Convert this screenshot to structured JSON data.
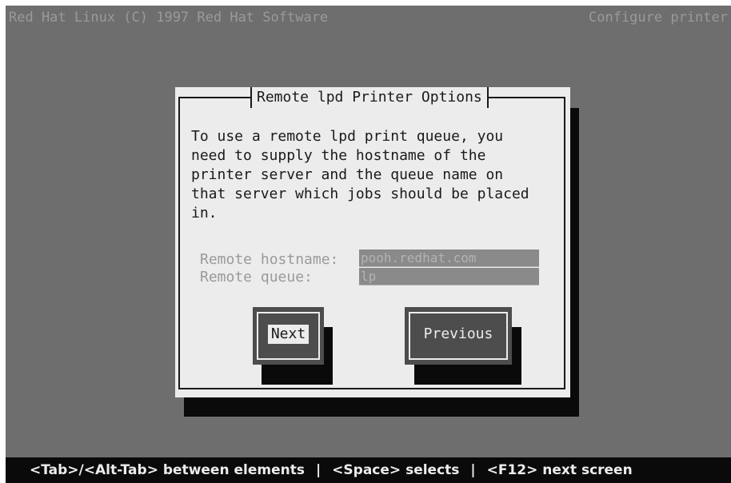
{
  "window": {
    "title_left": "Red Hat Linux (C) 1997 Red Hat Software",
    "title_right": "Configure printer"
  },
  "dialog": {
    "title": "Remote lpd Printer Options",
    "text_lines": [
      "To use a remote lpd print queue, you",
      "need to supply the hostname of the",
      "printer server and the queue name on",
      "that server which jobs should be placed",
      "in."
    ],
    "fields": {
      "hostname_label": "Remote hostname:",
      "hostname_value": "pooh.redhat.com",
      "queue_label": "Remote queue:",
      "queue_value": "lp"
    },
    "buttons": {
      "next": "Next",
      "previous": "Previous"
    }
  },
  "statusbar": {
    "hint1": "<Tab>/<Alt-Tab> between elements",
    "separator": "|",
    "hint2": "<Space> selects",
    "hint3": "<F12> next screen"
  },
  "colors": {
    "screen_bg": "#6e6e6e",
    "dialog_bg": "#ececec",
    "button_bg": "#4d4d4d",
    "statusbar_bg": "#0a0a0a"
  }
}
